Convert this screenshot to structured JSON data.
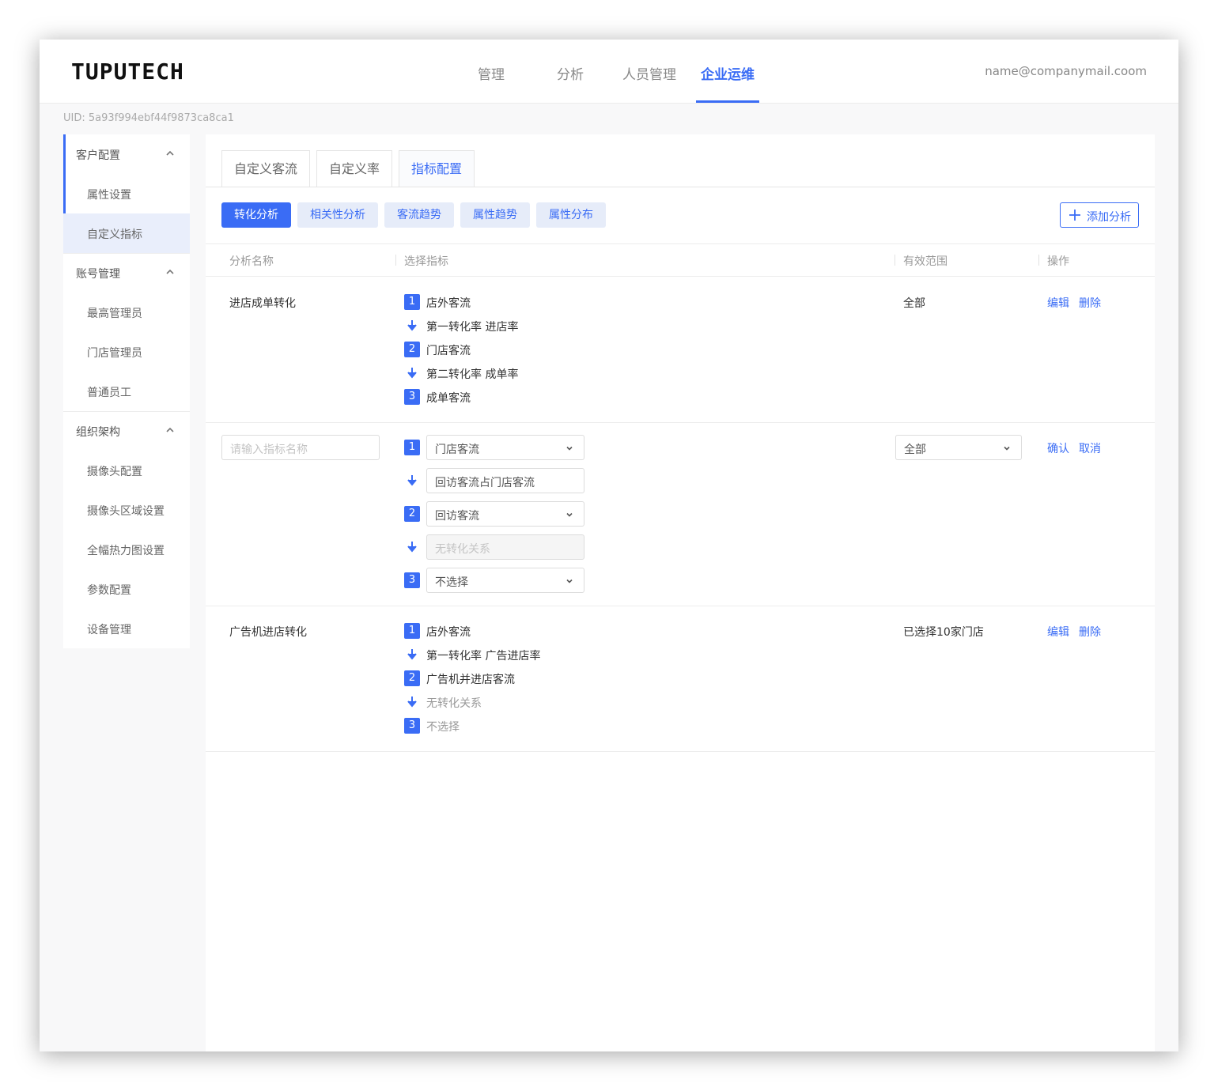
{
  "header": {
    "logo": "TUPUTECH",
    "nav": [
      "管理",
      "分析",
      "人员管理",
      "企业运维"
    ],
    "active_nav": "企业运维",
    "user_email": "name@companymail.coom"
  },
  "uid": "UID: 5a93f994ebf44f9873ca8ca1",
  "sidebar": {
    "groups": [
      {
        "label": "客户配置",
        "items": [
          "属性设置",
          "自定义指标"
        ]
      },
      {
        "label": "账号管理",
        "items": [
          "最高管理员",
          "门店管理员",
          "普通员工"
        ]
      },
      {
        "label": "组织架构",
        "items": [
          "摄像头配置",
          "摄像头区域设置",
          "全幅热力图设置",
          "参数配置",
          "设备管理"
        ]
      }
    ],
    "active_item": "自定义指标"
  },
  "tabs": [
    "自定义客流",
    "自定义率",
    "指标配置"
  ],
  "active_tab": "指标配置",
  "subtabs": [
    "转化分析",
    "相关性分析",
    "客流趋势",
    "属性趋势",
    "属性分布"
  ],
  "active_subtab": "转化分析",
  "add_button": "添加分析",
  "table": {
    "headers": [
      "分析名称",
      "选择指标",
      "有效范围",
      "操作"
    ],
    "rows": [
      {
        "name": "进店成单转化",
        "steps": [
          {
            "n": "1",
            "text": "店外客流"
          },
          {
            "rate": "第一转化率  进店率"
          },
          {
            "n": "2",
            "text": "门店客流"
          },
          {
            "rate": "第二转化率  成单率"
          },
          {
            "n": "3",
            "text": "成单客流"
          }
        ],
        "scope": "全部",
        "actions": [
          "编辑",
          "删除"
        ]
      },
      {
        "editing": true,
        "name_placeholder": "请输入指标名称",
        "step1": {
          "n": "1",
          "value": "门店客流"
        },
        "rate1": "回访客流占门店客流",
        "step2": {
          "n": "2",
          "value": "回访客流"
        },
        "rate2_placeholder": "无转化关系",
        "step3": {
          "n": "3",
          "value": "不选择"
        },
        "scope": "全部",
        "actions": [
          "确认",
          "取消"
        ]
      },
      {
        "name": "广告机进店转化",
        "steps": [
          {
            "n": "1",
            "text": "店外客流"
          },
          {
            "rate": "第一转化率  广告进店率"
          },
          {
            "n": "2",
            "text": "广告机并进店客流"
          },
          {
            "rate": "无转化关系"
          },
          {
            "n": "3",
            "text": "不选择"
          }
        ],
        "scope": "已选择10家门店",
        "actions": [
          "编辑",
          "删除"
        ]
      }
    ]
  },
  "colors": {
    "accent": "#3a6cf5",
    "chip_bg": "#e6ecf9",
    "sidebar_active_bg": "#e9eefb"
  }
}
